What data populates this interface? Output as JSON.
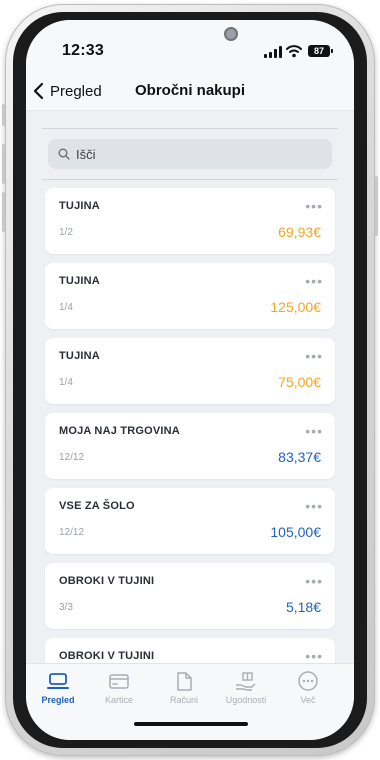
{
  "status_bar": {
    "time": "12:33",
    "battery": "87"
  },
  "header": {
    "back_label": "Pregled",
    "title": "Obročni nakupi"
  },
  "search": {
    "placeholder": "Išči"
  },
  "colors": {
    "orange": "#f5a623",
    "blue": "#1f63c6",
    "accent": "#1f5fbf",
    "inactive": "#a9aeb5"
  },
  "items": [
    {
      "title": "TUJINA",
      "count": "1/2",
      "amount": "69,93€",
      "tone": "orange"
    },
    {
      "title": "TUJINA",
      "count": "1/4",
      "amount": "125,00€",
      "tone": "orange"
    },
    {
      "title": "TUJINA",
      "count": "1/4",
      "amount": "75,00€",
      "tone": "orange"
    },
    {
      "title": "MOJA NAJ TRGOVINA",
      "count": "12/12",
      "amount": "83,37€",
      "tone": "blue"
    },
    {
      "title": "VSE ZA ŠOLO",
      "count": "12/12",
      "amount": "105,00€",
      "tone": "blue"
    },
    {
      "title": "OBROKI V TUJINI",
      "count": "3/3",
      "amount": "5,18€",
      "tone": "blue"
    },
    {
      "title": "OBROKI V TUJINI",
      "count": "",
      "amount": "",
      "tone": "blue"
    }
  ],
  "tabs": [
    {
      "label": "Pregled",
      "icon": "overview-icon",
      "active": true
    },
    {
      "label": "Kartice",
      "icon": "card-icon",
      "active": false
    },
    {
      "label": "Računi",
      "icon": "document-icon",
      "active": false
    },
    {
      "label": "Ugodnosti",
      "icon": "gift-hand-icon",
      "active": false
    },
    {
      "label": "Več",
      "icon": "more-icon",
      "active": false
    }
  ]
}
